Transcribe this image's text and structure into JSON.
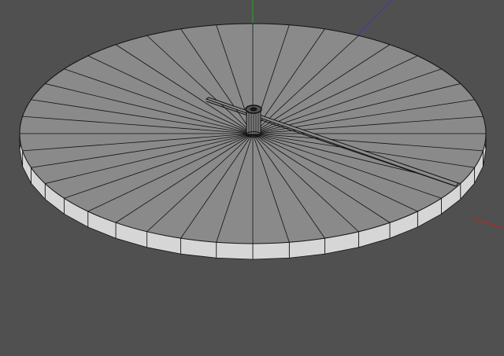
{
  "viewport": {
    "background": "#505050",
    "label": ""
  },
  "model": {
    "name": "",
    "disc": {
      "segments": 40,
      "top_color": "#8a8a8a",
      "side_color": "#d6d6d6",
      "wire_color": "#111111"
    },
    "hub": {
      "color": "#7d7d7d"
    },
    "hand": {
      "color": "#8c8c8c"
    }
  },
  "axes": {
    "y_color": "#22aa22",
    "x_color": "#cc2222",
    "z_color": "#3a3ab0"
  }
}
